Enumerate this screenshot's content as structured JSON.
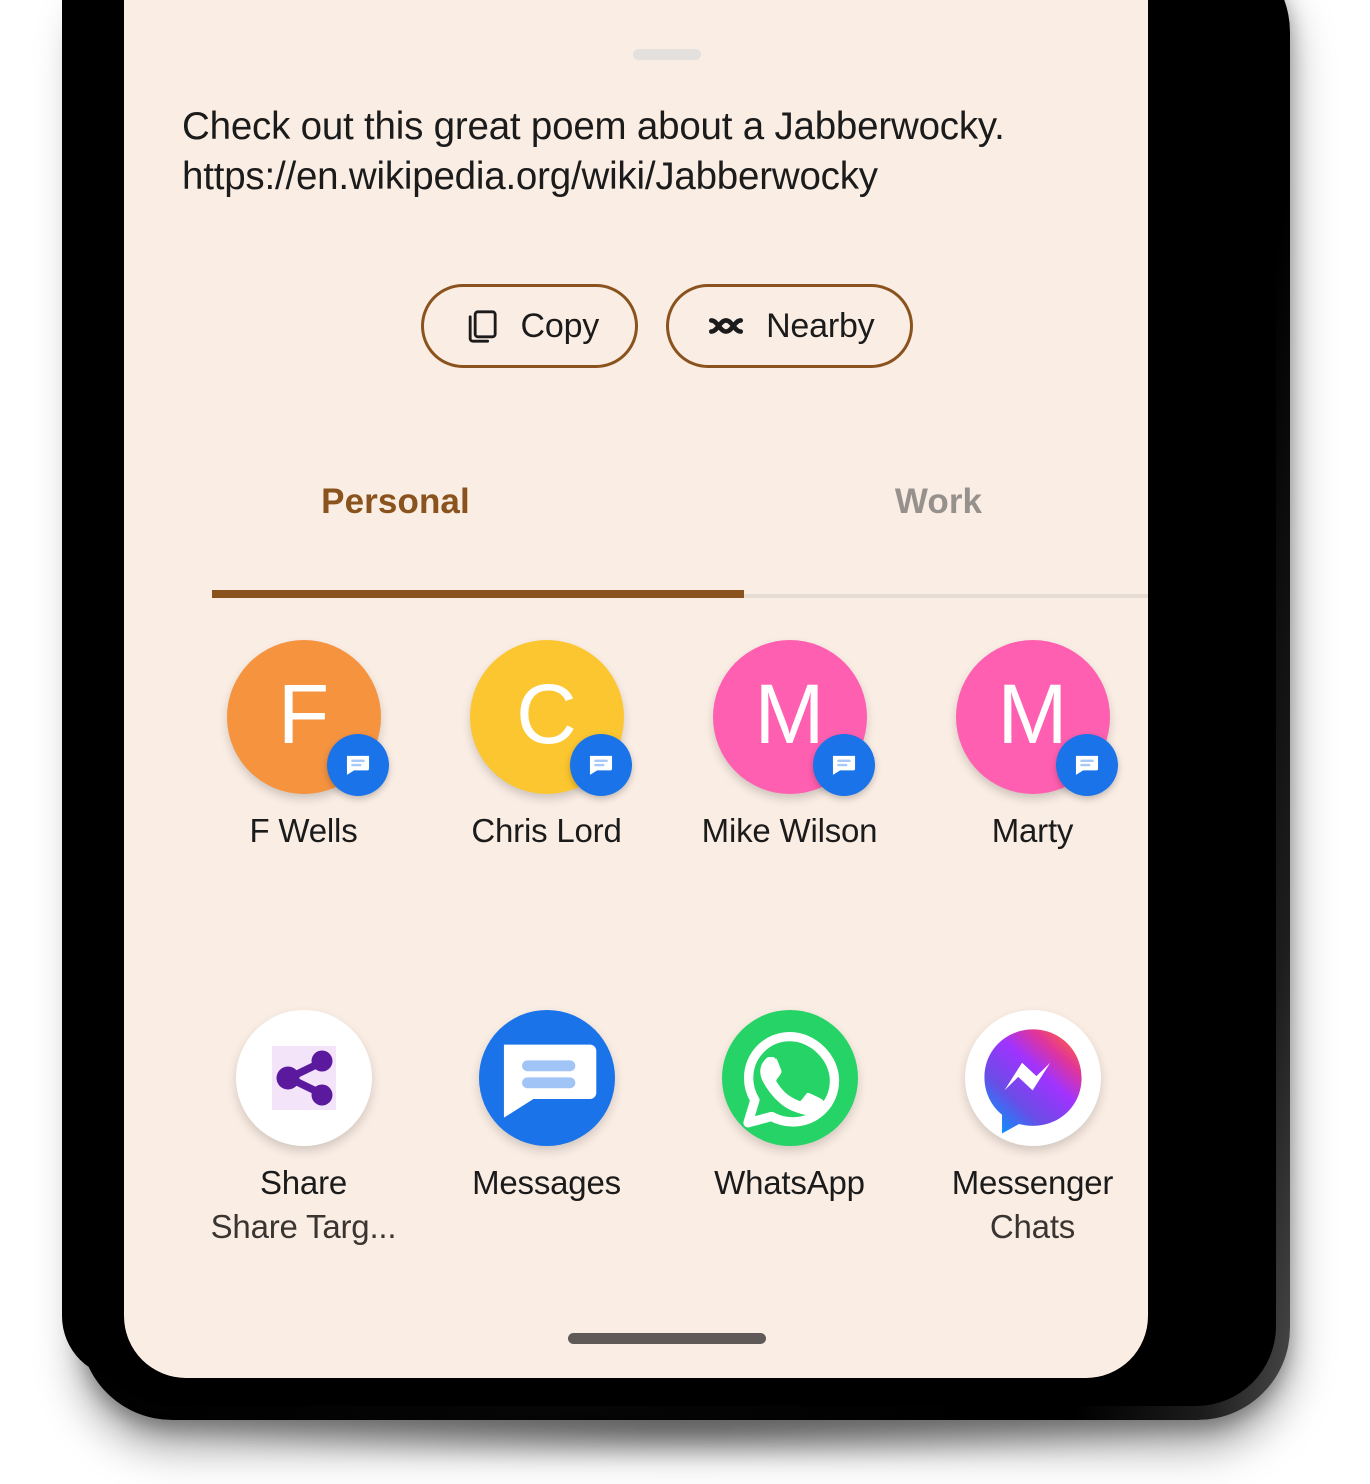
{
  "sheet": {
    "preview_text": "Check out this great poem about a Jabberwocky.\nhttps://en.wikipedia.org/wiki/Jabberwocky",
    "background_color": "#FAEDE4",
    "accent_color": "#8A521C",
    "drag_handle_label": "drag-handle"
  },
  "actions": [
    {
      "label": "Copy",
      "icon": "copy-icon"
    },
    {
      "label": "Nearby",
      "icon": "nearby-share-icon"
    }
  ],
  "tabs": [
    {
      "label": "Personal",
      "active": true
    },
    {
      "label": "Work",
      "active": false
    }
  ],
  "contacts": [
    {
      "name": "F Wells",
      "initial": "F",
      "color": "#F5933F",
      "badge": "messages-icon"
    },
    {
      "name": "Chris Lord",
      "initial": "C",
      "color": "#FBC62F",
      "badge": "messages-icon"
    },
    {
      "name": "Mike Wilson",
      "initial": "M",
      "color": "#FF5FB0",
      "badge": "messages-icon"
    },
    {
      "name": "Marty",
      "initial": "M",
      "color": "#FF5FB0",
      "badge": "messages-icon"
    }
  ],
  "apps": [
    {
      "label": "Share",
      "sublabel": "Share Targ...",
      "icon": "share-nodes-icon"
    },
    {
      "label": "Messages",
      "sublabel": "",
      "icon": "messages-icon"
    },
    {
      "label": "WhatsApp",
      "sublabel": "",
      "icon": "whatsapp-icon"
    },
    {
      "label": "Messenger",
      "sublabel": "Chats",
      "icon": "messenger-icon"
    }
  ],
  "system": {
    "gesture_bar_label": "gesture-navigation-bar"
  }
}
